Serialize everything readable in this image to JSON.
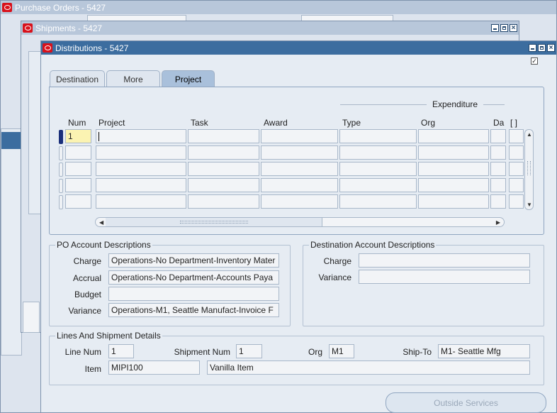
{
  "windows": {
    "purchase_orders": {
      "title": "Purchase Orders - 5427"
    },
    "shipments": {
      "title": "Shipments - 5427"
    },
    "distributions": {
      "title": "Distributions - 5427"
    }
  },
  "tabs": [
    {
      "label": "Destination"
    },
    {
      "label": "More"
    },
    {
      "label": "Project"
    }
  ],
  "grid": {
    "group_header": "Expenditure",
    "columns": [
      "Num",
      "Project",
      "Task",
      "Award",
      "Type",
      "Org",
      "Da",
      "[ ]"
    ],
    "row1_num": "1"
  },
  "po_account": {
    "title": "PO Account Descriptions",
    "charge_label": "Charge",
    "charge_value": "Operations-No Department-Inventory Mater",
    "accrual_label": "Accrual",
    "accrual_value": "Operations-No Department-Accounts Paya",
    "budget_label": "Budget",
    "budget_value": "",
    "variance_label": "Variance",
    "variance_value": "Operations-M1, Seattle Manufact-Invoice F"
  },
  "dest_account": {
    "title": "Destination Account Descriptions",
    "charge_label": "Charge",
    "charge_value": "",
    "variance_label": "Variance",
    "variance_value": ""
  },
  "lines": {
    "title": "Lines And Shipment Details",
    "line_num_label": "Line Num",
    "line_num_value": "1",
    "shipment_num_label": "Shipment Num",
    "shipment_num_value": "1",
    "org_label": "Org",
    "org_value": "M1",
    "ship_to_label": "Ship-To",
    "ship_to_value": "M1- Seattle Mfg",
    "item_label": "Item",
    "item_value": "MIPI100",
    "item_desc": "Vanilla Item"
  },
  "buttons": {
    "outside_services": "Outside Services"
  },
  "colors": {
    "titlebar_active": "#3c6d9f",
    "titlebar_inactive": "#b8c7da",
    "oracle_red": "#d8111b",
    "current_field": "#fbf3b2"
  }
}
